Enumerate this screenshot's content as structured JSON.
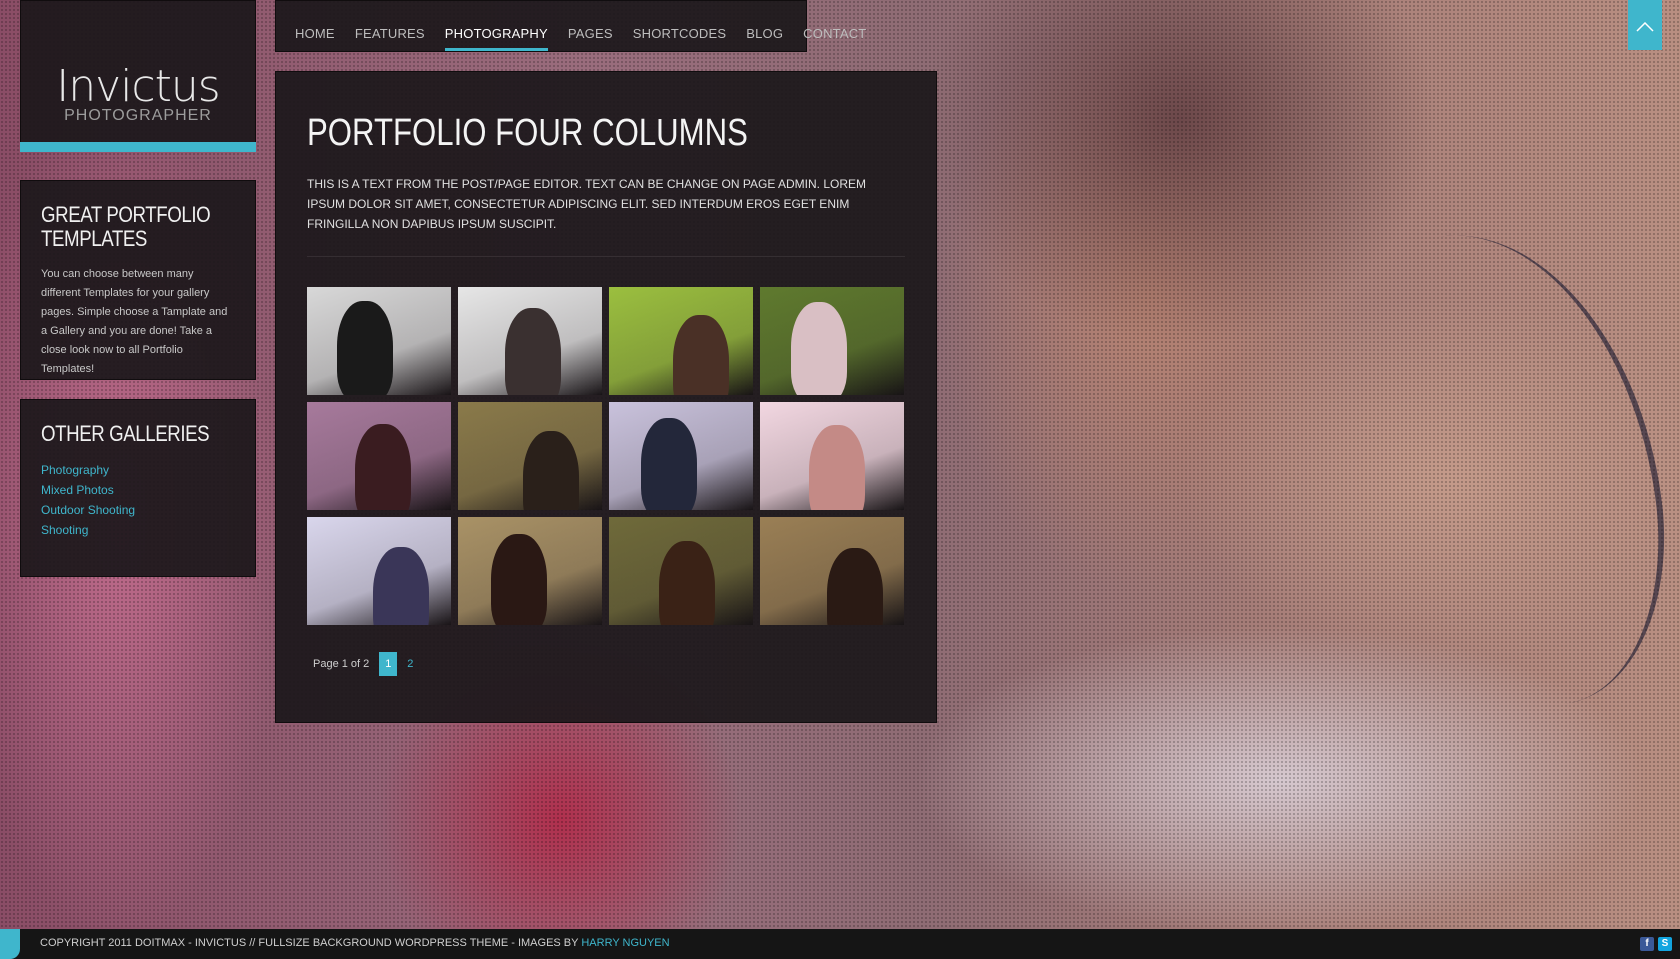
{
  "logo": {
    "title": "Invictus",
    "subtitle": "PHOTOGRAPHER"
  },
  "nav": {
    "items": [
      {
        "label": "HOME"
      },
      {
        "label": "FEATURES"
      },
      {
        "label": "PHOTOGRAPHY",
        "active": true
      },
      {
        "label": "PAGES"
      },
      {
        "label": "SHORTCODES"
      },
      {
        "label": "BLOG"
      },
      {
        "label": "CONTACT"
      }
    ]
  },
  "sidebar": {
    "widget1": {
      "title": "GREAT PORTFOLIO TEMPLATES",
      "text": "You can choose between many different Templates for your gallery pages. Simple choose a Tamplate and a Gallery and you are done! Take a close look now to all Portfolio Templates!"
    },
    "widget2": {
      "title": "OTHER GALLERIES",
      "links": [
        "Photography",
        "Mixed Photos",
        "Outdoor Shooting",
        "Shooting"
      ]
    }
  },
  "main": {
    "title": "PORTFOLIO FOUR COLUMNS",
    "intro": "THIS IS A TEXT FROM THE POST/PAGE EDITOR. TEXT CAN BE CHANGE ON PAGE ADMIN. LOREM IPSUM DOLOR SIT AMET, CONSECTETUR ADIPISCING ELIT. SED INTERDUM EROS EGET ENIM FRINGILLA NON DAPIBUS IPSUM SUSCIPIT.",
    "thumbnails": [
      {
        "bg": "#d8d8d8",
        "fg": "#1a1a1a"
      },
      {
        "bg": "#e6e6e6",
        "fg": "#3a3030"
      },
      {
        "bg": "#9bbf3f",
        "fg": "#4a3026"
      },
      {
        "bg": "#5f7a2e",
        "fg": "#d9bfc4"
      },
      {
        "bg": "#a77a9c",
        "fg": "#3a1c20"
      },
      {
        "bg": "#8a7a4a",
        "fg": "#2a201a"
      },
      {
        "bg": "#c9c2dc",
        "fg": "#23273a"
      },
      {
        "bg": "#f2d7e1",
        "fg": "#c48a86"
      },
      {
        "bg": "#d9d6ec",
        "fg": "#3a3658"
      },
      {
        "bg": "#a99266",
        "fg": "#2a1814"
      },
      {
        "bg": "#6f6a3a",
        "fg": "#3a2216"
      },
      {
        "bg": "#9a7f55",
        "fg": "#2a1a14"
      }
    ]
  },
  "pagination": {
    "info": "Page 1 of 2",
    "pages": [
      "1",
      "2"
    ],
    "current": "1"
  },
  "footer": {
    "text": "COPYRIGHT 2011 DOITMAX - INVICTUS // FULLSIZE BACKGROUND WORDPRESS THEME - IMAGES BY",
    "link": "HARRY NGUYEN",
    "social": [
      "facebook-icon",
      "skype-icon"
    ]
  },
  "colors": {
    "accent": "#3fb6cc",
    "panel": "#1c181b",
    "footer": "#151515"
  }
}
